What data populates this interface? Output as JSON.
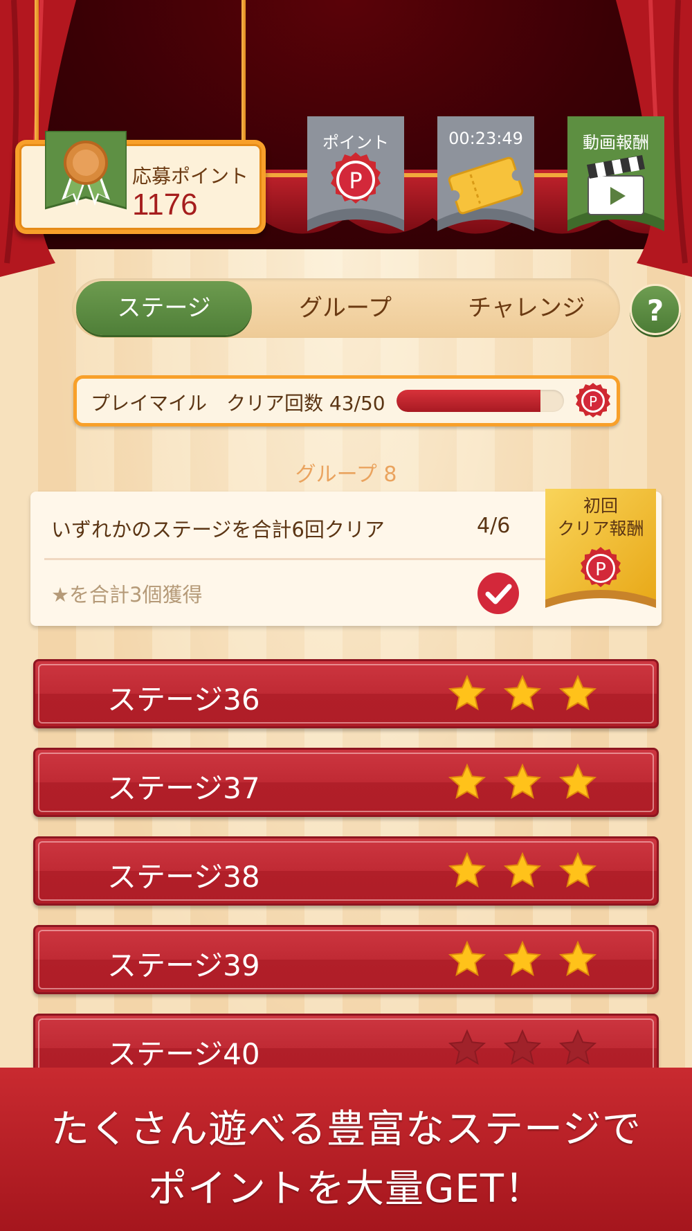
{
  "header": {
    "points_label": "応募ポイント",
    "points_value": "1176",
    "banners": [
      {
        "label": "ポイント",
        "icon": "point-coin-icon",
        "color": "#8e939c"
      },
      {
        "label": "00:23:49",
        "icon": "ticket-icon",
        "color": "#8e939c"
      },
      {
        "label": "動画報酬",
        "icon": "clapperboard-icon",
        "color": "#5d8f41"
      }
    ]
  },
  "tabs": {
    "items": [
      "ステージ",
      "グループ",
      "チャレンジ"
    ],
    "active": 0,
    "help": "?"
  },
  "progress": {
    "label": "プレイマイル　クリア回数 43/50",
    "current": 43,
    "total": 50
  },
  "group": {
    "title": "グループ 8",
    "missions": [
      {
        "text": "いずれかのステージを合計6回クリア",
        "status": "4/6"
      },
      {
        "text": "★を合計3個獲得",
        "status": "completed"
      }
    ],
    "reward_label_line1": "初回",
    "reward_label_line2": "クリア報酬"
  },
  "stages": [
    {
      "name": "ステージ36",
      "stars": 3
    },
    {
      "name": "ステージ37",
      "stars": 3
    },
    {
      "name": "ステージ38",
      "stars": 3
    },
    {
      "name": "ステージ39",
      "stars": 3
    },
    {
      "name": "ステージ40",
      "stars": 0
    }
  ],
  "promo": {
    "line1": "たくさん遊べる豊富なステージで",
    "line2": "ポイントを大量GET！"
  },
  "colors": {
    "accent_red": "#b01d27",
    "accent_green": "#4f7f38",
    "board_orange": "#f8a02a",
    "star_gold": "#ffc21a"
  }
}
